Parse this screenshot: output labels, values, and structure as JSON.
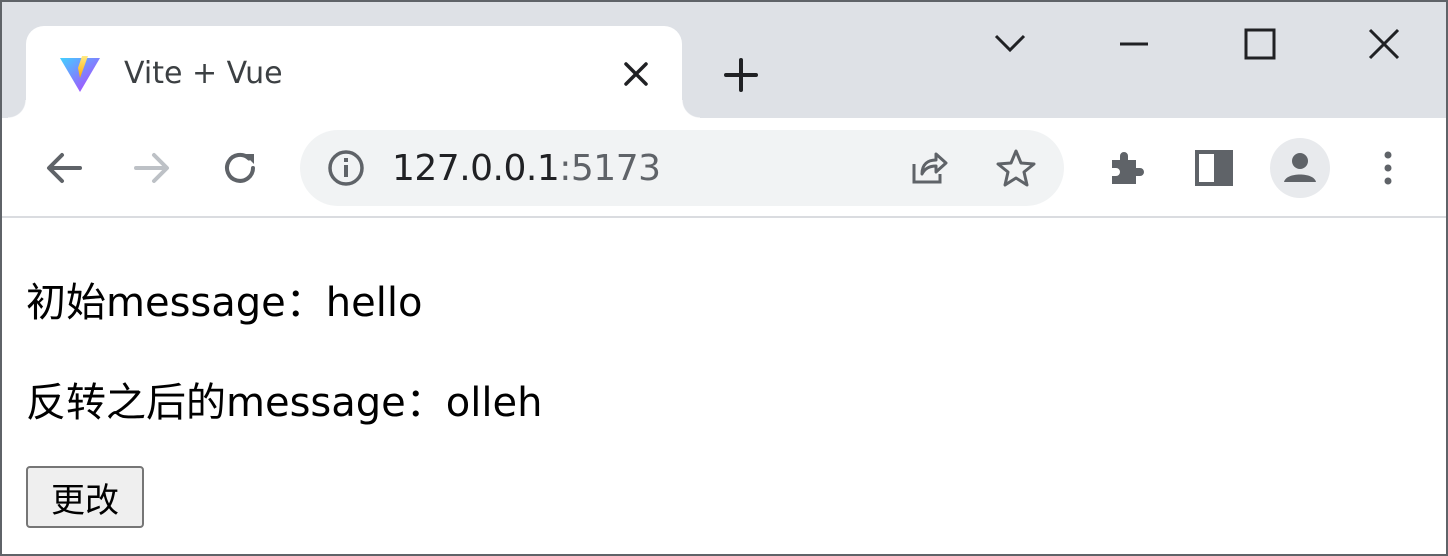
{
  "browser": {
    "tab": {
      "title": "Vite + Vue"
    },
    "address_bar": {
      "host": "127.0.0.1",
      "port": ":5173"
    },
    "icons": [
      "vite-favicon",
      "close-icon",
      "plus-icon",
      "chevron-down-icon",
      "minimize-icon",
      "maximize-icon",
      "window-close-icon",
      "back-arrow-icon",
      "forward-arrow-icon",
      "reload-icon",
      "info-icon",
      "share-icon",
      "star-icon",
      "extensions-icon",
      "side-panel-icon",
      "profile-icon",
      "menu-dots-icon"
    ]
  },
  "page": {
    "initial_label": "初始message：",
    "initial_value": "hello",
    "reversed_label": "反转之后的message：",
    "reversed_value": "olleh",
    "change_button": "更改"
  },
  "colors": {
    "tabstrip": "#dee1e6",
    "omnibox": "#f1f3f4",
    "icon": "#5f6368"
  }
}
